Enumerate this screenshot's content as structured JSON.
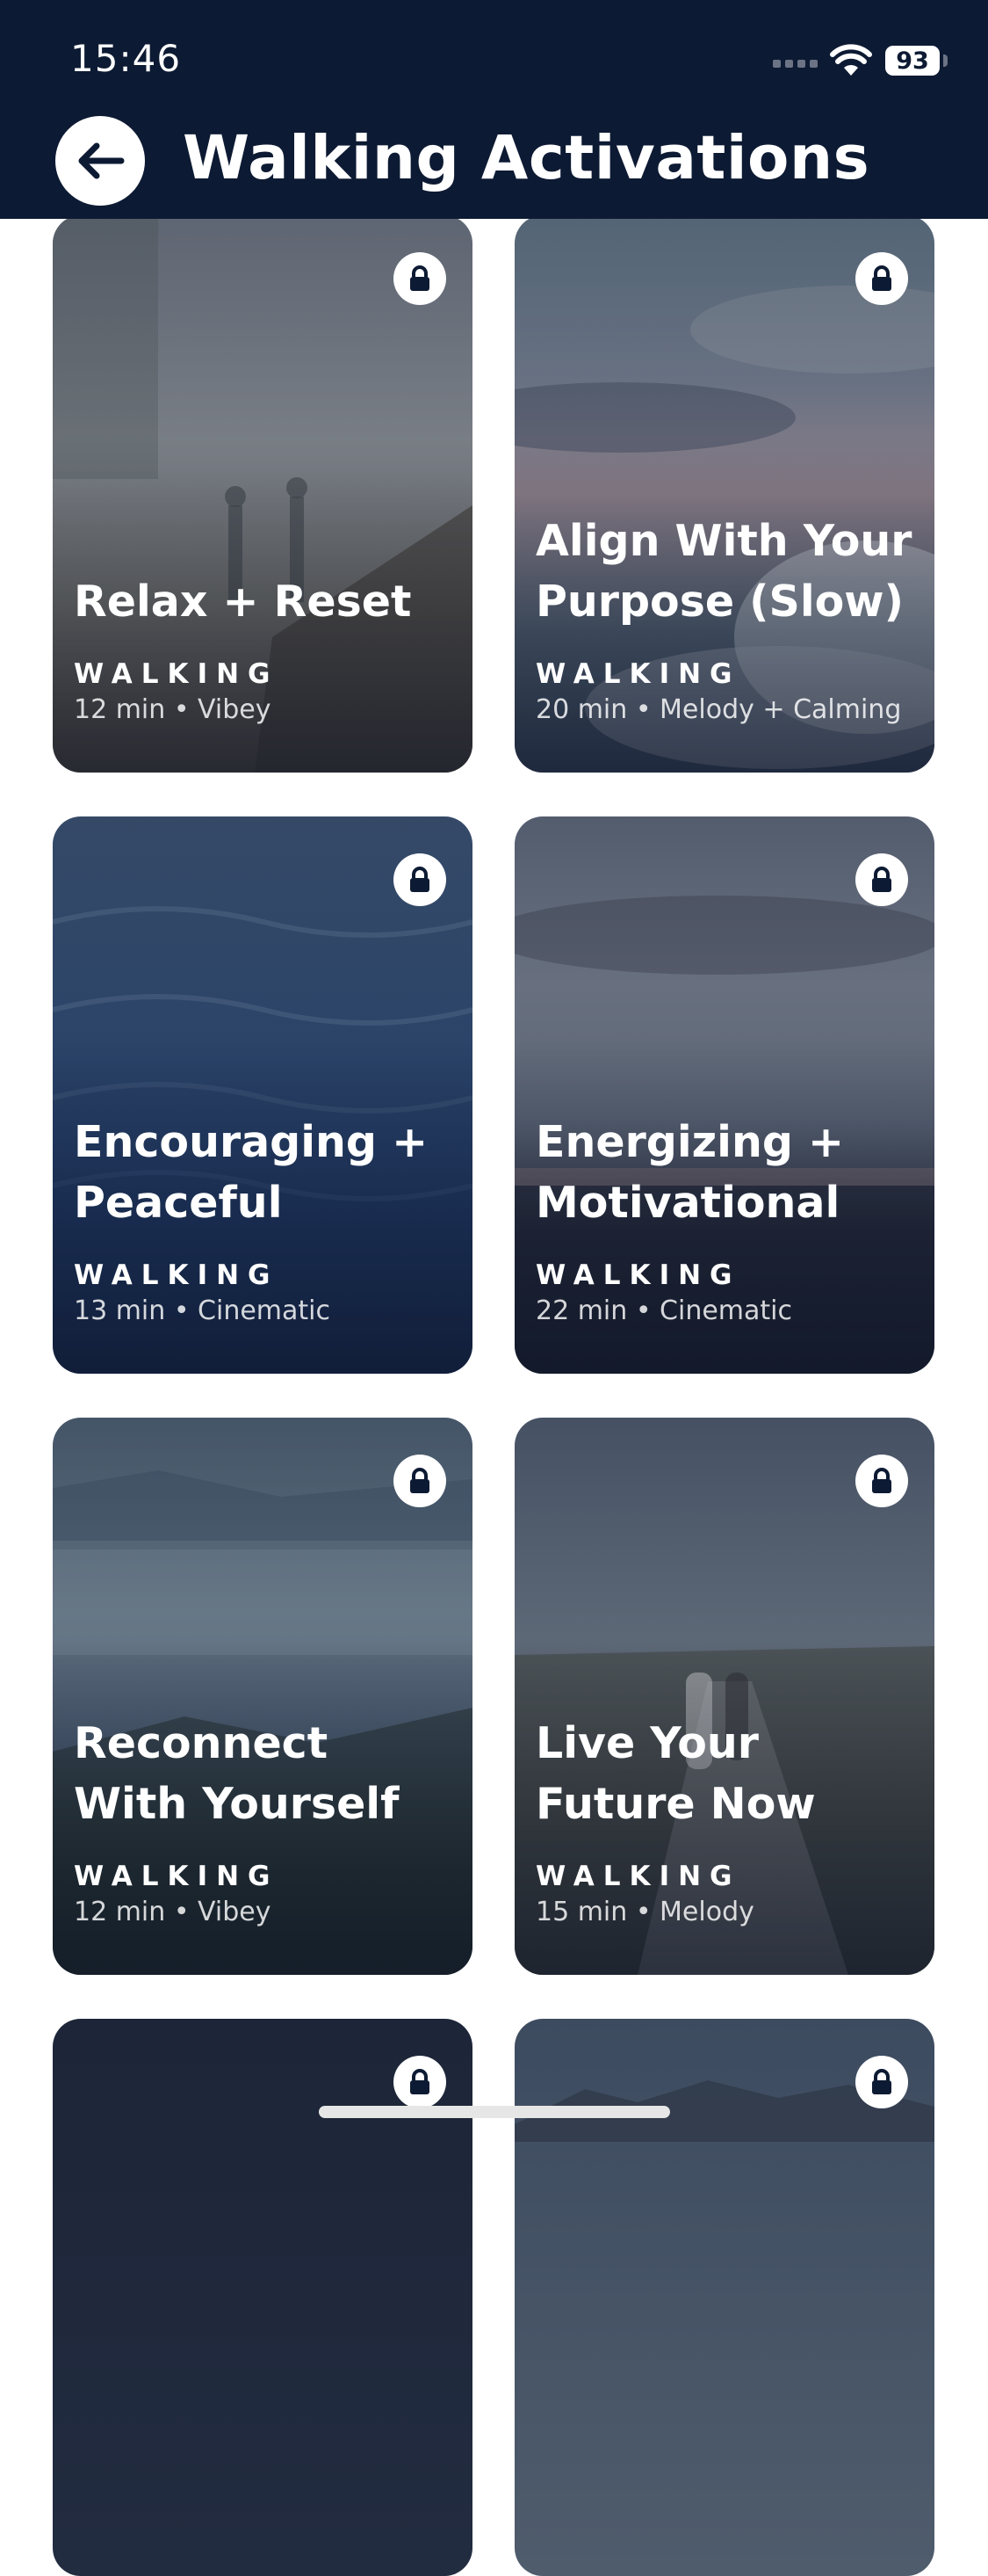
{
  "status_bar": {
    "time": "15:46",
    "battery": "93"
  },
  "header": {
    "title": "Walking Activations"
  },
  "cards": [
    {
      "title": "Relax + Reset",
      "category": "WALKING",
      "meta": "12 min • Vibey"
    },
    {
      "title": "Align With Your Purpose (Slow)",
      "category": "WALKING",
      "meta": "20 min • Melody + Calming"
    },
    {
      "title": "Encouraging + Peaceful",
      "category": "WALKING",
      "meta": "13 min • Cinematic"
    },
    {
      "title": "Energizing + Motivational",
      "category": "WALKING",
      "meta": "22 min • Cinematic"
    },
    {
      "title": "Reconnect With Yourself",
      "category": "WALKING",
      "meta": "12 min • Vibey"
    },
    {
      "title": "Live Your Future Now",
      "category": "WALKING",
      "meta": "15 min • Melody"
    }
  ],
  "icons": {
    "back": "arrow-left-icon",
    "lock": "lock-icon",
    "wifi": "wifi-icon",
    "signal": "cellular-signal-icon",
    "battery": "battery-icon"
  },
  "colors": {
    "header_bg": "#0d1a33",
    "card_text": "#ffffff"
  }
}
